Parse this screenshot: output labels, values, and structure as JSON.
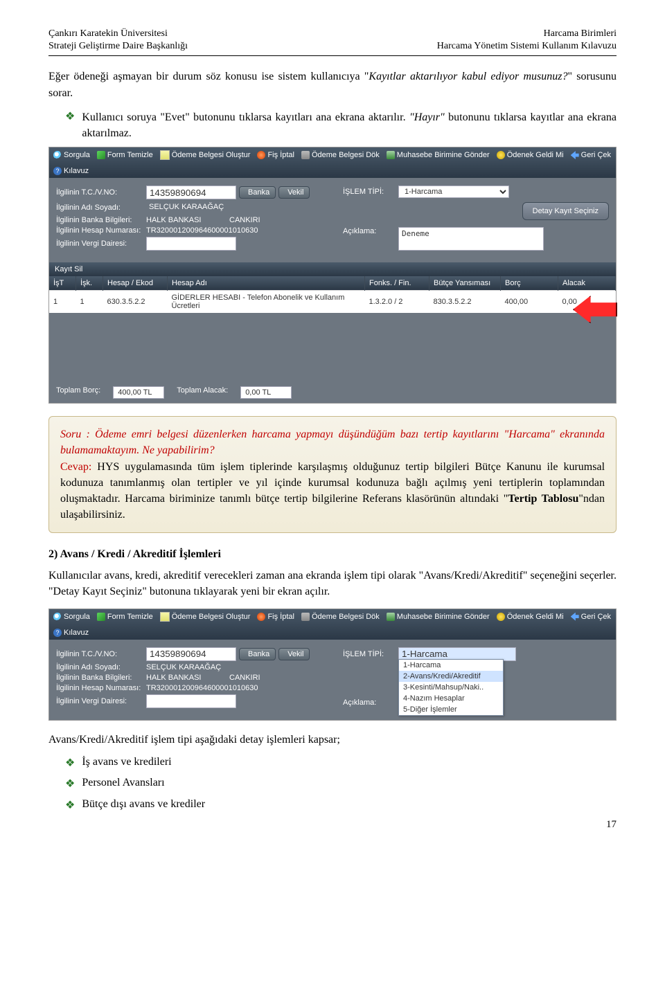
{
  "header": {
    "left1": "Çankırı Karatekin Üniversitesi",
    "left2": "Strateji Geliştirme Daire Başkanlığı",
    "right1": "Harcama Birimleri",
    "right2": "Harcama Yönetim Sistemi Kullanım Kılavuzu"
  },
  "para1_a": "Eğer ödeneği aşmayan bir durum söz konusu ise sistem kullanıcıya \"",
  "para1_b": "Kayıtlar aktarılıyor kabul ediyor musunuz?",
  "para1_c": "\" sorusunu sorar.",
  "bullet1_a": "Kullanıcı soruya \"Evet\" butonunu tıklarsa kayıtları ana ekrana aktarılır. ",
  "bullet1_b": "\"Hayır\"",
  "bullet1_c": " butonunu tıklarsa kayıtlar ana ekrana aktarılmaz.",
  "toolbar": {
    "sorgula": "Sorgula",
    "form_temizle": "Form Temizle",
    "odeme_olustur": "Ödeme Belgesi Oluştur",
    "fis_iptal": "Fiş İptal",
    "odeme_dok": "Ödeme Belgesi Dök",
    "muhasebe_gonder": "Muhasebe Birimine Gönder",
    "odenek_geldi": "Ödenek Geldi Mi",
    "geri_cek": "Geri Çek",
    "kilavuz": "Kılavuz"
  },
  "form": {
    "tc_label": "İlgilinin T.C./V.NO:",
    "tc_val": "14359890694",
    "banka_btn": "Banka",
    "vekil_btn": "Vekil",
    "ad_label": "İlgilinin Adı Soyadı:",
    "ad_val": "SELÇUK KARAAĞAÇ",
    "banka_label": "İlgilinin Banka Bilgileri:",
    "banka_val": "HALK BANKASI",
    "sube_val": "CANKIRI",
    "hesap_label": "İlgilinin Hesap Numarası:",
    "hesap_val": "TR320001200964600001010630",
    "vergi_label": "İlgilinin Vergi Dairesi:",
    "vergi_val": "",
    "islem_tipi_label": "İŞLEM TİPİ:",
    "islem_tipi_val": "1-Harcama",
    "detay_btn": "Detay Kayıt Seçiniz",
    "aciklama_label": "Açıklama:",
    "aciklama_val": "Deneme"
  },
  "section_label": "Kayıt Sil",
  "table": {
    "h1": "İşT",
    "h2": "İşk.",
    "h3": "Hesap / Ekod",
    "h4": "Hesap Adı",
    "h5": "Fonks. / Fin.",
    "h6": "Bütçe Yansıması",
    "h7": "Borç",
    "h8": "Alacak",
    "r1": {
      "c1": "1",
      "c2": "1",
      "c3": "630.3.5.2.2",
      "c4": "GİDERLER HESABI - Telefon Abonelik ve Kullanım Ücretleri",
      "c5": "1.3.2.0 / 2",
      "c6": "830.3.5.2.2",
      "c7": "400,00",
      "c8": "0,00"
    }
  },
  "footer": {
    "borc_label": "Toplam Borç:",
    "borc_val": "400,00 TL",
    "alacak_label": "Toplam Alacak:",
    "alacak_val": "0,00 TL"
  },
  "callout": {
    "soru_lead": "Soru : ",
    "soru_body": "Ödeme emri belgesi düzenlerken harcama yapmayı düşündüğüm bazı tertip kayıtlarını \"Harcama\" ekranında bulamamaktayım. Ne yapabilirim?",
    "cevap_lead": "Cevap:",
    "cevap_body_a": " HYS uygulamasında tüm işlem tiplerinde karşılaşmış olduğunuz tertip bilgileri Bütçe Kanunu ile kurumsal kodunuza tanımlanmış olan tertipler ve yıl içinde kurumsal kodunuza bağlı açılmış yeni tertiplerin toplamından oluşmaktadır. Harcama biriminize tanımlı bütçe tertip bilgilerine Referans klasörünün altındaki \"",
    "cevap_body_b": "Tertip Tablosu",
    "cevap_body_c": "\"ndan ulaşabilirsiniz."
  },
  "heading2": "2) Avans / Kredi / Akreditif İşlemleri",
  "para2": "Kullanıcılar avans, kredi, akreditif verecekleri zaman ana ekranda işlem tipi olarak \"Avans/Kredi/Akreditif\" seçeneğini seçerler. \"Detay Kayıt Seçiniz\" butonuna tıklayarak yeni bir ekran açılır.",
  "dropdown": {
    "opt1": "1-Harcama",
    "opt2": "2-Avans/Kredi/Akreditif",
    "opt3": "3-Kesinti/Mahsup/Naki..",
    "opt4": "4-Nazım Hesaplar",
    "opt5": "5-Diğer İşlemler"
  },
  "para3": "Avans/Kredi/Akreditif işlem tipi aşağıdaki detay işlemleri kapsar;",
  "list": {
    "i1": "İş avans ve kredileri",
    "i2": "Personel Avansları",
    "i3": "Bütçe dışı avans ve krediler"
  },
  "pagenum": "17",
  "chart_data": {
    "type": "table",
    "columns": [
      "İşT",
      "İşk.",
      "Hesap / Ekod",
      "Hesap Adı",
      "Fonks. / Fin.",
      "Bütçe Yansıması",
      "Borç",
      "Alacak"
    ],
    "rows": [
      [
        "1",
        "1",
        "630.3.5.2.2",
        "GİDERLER HESABI - Telefon Abonelik ve Kullanım Ücretleri",
        "1.3.2.0 / 2",
        "830.3.5.2.2",
        "400,00",
        "0,00"
      ]
    ],
    "totals": {
      "Toplam Borç": "400,00 TL",
      "Toplam Alacak": "0,00 TL"
    }
  }
}
